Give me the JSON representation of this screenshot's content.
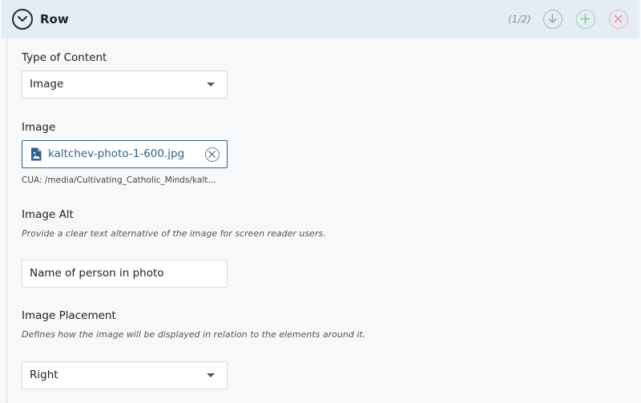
{
  "header": {
    "title": "Row",
    "counter": "(1/2)",
    "icons": {
      "collapse": "chevron-down-icon",
      "move_down": "arrow-down-icon",
      "add": "plus-icon",
      "remove": "close-icon"
    },
    "colors": {
      "background": "#e4ecf4",
      "add": "#7ccc8a",
      "remove": "#ee9a9a",
      "move": "#9aa6b2"
    }
  },
  "fields": {
    "content_type": {
      "label": "Type of Content",
      "value": "Image"
    },
    "image": {
      "label": "Image",
      "filename": "kaltchev-photo-1-600.jpg",
      "path": "CUA: /media/Cultivating_Catholic_Minds/kalt..."
    },
    "image_alt": {
      "label": "Image Alt",
      "help": "Provide a clear text alternative of the image for screen reader users.",
      "value": "Name of person in photo"
    },
    "image_placement": {
      "label": "Image Placement",
      "help": "Defines how the image will be displayed in relation to the elements around it.",
      "value": "Right"
    }
  },
  "accent_color": "#2e5f92"
}
